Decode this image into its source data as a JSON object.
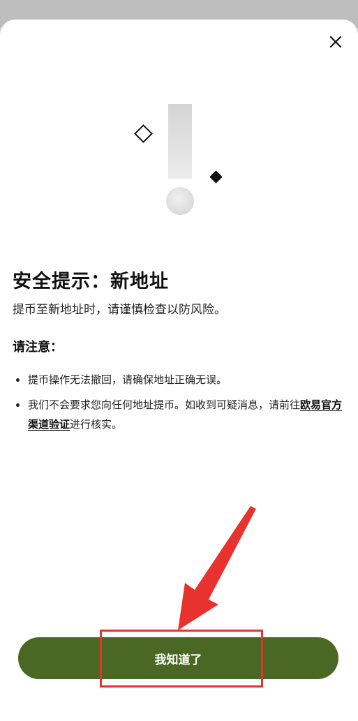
{
  "dialog": {
    "close_icon": "close-icon",
    "illustration_icon": "warning-exclamation-icon",
    "title": "安全提示：新地址",
    "subtitle": "提币至新地址时，请谨慎检查以防风险。",
    "notice_heading": "请注意：",
    "notices": [
      {
        "text": "提币操作无法撤回，请确保地址正确无误。"
      },
      {
        "text_before": "我们不会要求您向任何地址提币。如收到可疑消息，请前往",
        "link_text": "欧易官方渠道验证",
        "text_after": "进行核实。"
      }
    ],
    "confirm_label": "我知道了"
  },
  "colors": {
    "primary_button": "#4a6824",
    "annotation": "#e8322d",
    "text": "#111111",
    "backdrop": "#c9c9c9"
  }
}
